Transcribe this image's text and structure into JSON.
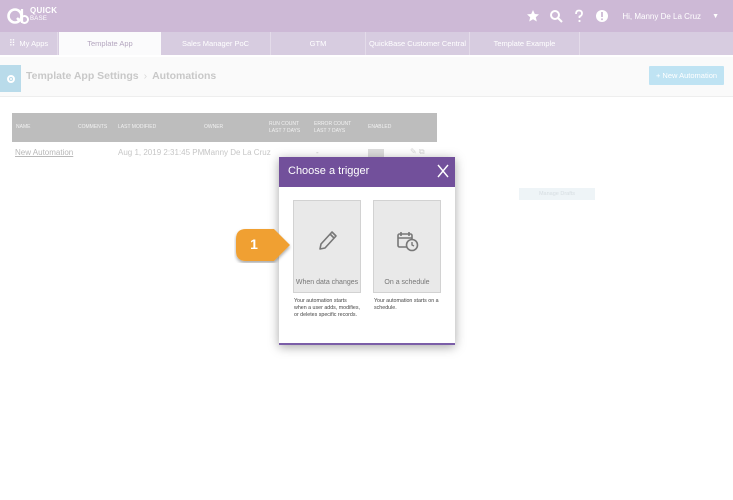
{
  "brand": {
    "logo_line1": "QUICK",
    "logo_line2": "BASE",
    "icon": "quickbase-logo"
  },
  "header_actions": {
    "icons": [
      "star-icon",
      "search-icon",
      "help-icon",
      "alert-icon"
    ],
    "user_greeting": "Hi, Manny De La Cruz"
  },
  "tabs": [
    {
      "label": "My Apps",
      "icon": "grid-icon"
    },
    {
      "label": "Template App",
      "active": true
    },
    {
      "label": "Sales Manager PoC"
    },
    {
      "label": "GTM"
    },
    {
      "label": "QuickBase Customer Central"
    },
    {
      "label": "Template Example"
    }
  ],
  "page": {
    "breadcrumb_root": "Template App Settings",
    "breadcrumb_separator": "›",
    "breadcrumb_current": "Automations",
    "new_button": "+ New Automation",
    "faint_button": "Manage Drafts"
  },
  "table": {
    "columns": [
      "NAME",
      "COMMENTS",
      "LAST MODIFIED",
      "OWNER",
      "RUN COUNT LAST 7 DAYS",
      "ERROR COUNT LAST 7 DAYS",
      "ENABLED"
    ],
    "rows": [
      {
        "name": "New Automation",
        "last_modified": "Aug 1, 2019 2:31:45 PM",
        "owner": "Manny De La Cruz",
        "run_count": "-",
        "error_count": "-"
      }
    ]
  },
  "modal": {
    "title": "Choose a trigger",
    "close_icon": "close-icon",
    "options": [
      {
        "label": "When data changes",
        "icon": "pencil-icon",
        "description": "Your automation starts when a user adds, modifies, or deletes specific records."
      },
      {
        "label": "On a schedule",
        "icon": "calendar-clock-icon",
        "description": "Your automation starts on a schedule."
      }
    ]
  },
  "step_badge": {
    "number": "1"
  },
  "colors": {
    "topbar": "#cdb9d6",
    "modal_header": "#72509b",
    "badge": "#f0a030",
    "new_button": "#bfe3f3"
  }
}
